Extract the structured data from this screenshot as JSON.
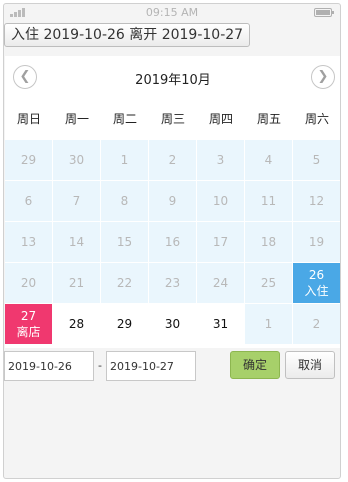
{
  "status_bar": {
    "time": "09:15 AM",
    "icons": [
      "signal-icon",
      "battery-icon"
    ]
  },
  "range_button": {
    "label": "入住 2019-10-26 离开 2019-10-27"
  },
  "calendar": {
    "title": "2019年10月",
    "prev_icon": "chevron-left-icon",
    "next_icon": "chevron-right-icon",
    "weekdays": [
      "周日",
      "周一",
      "周二",
      "周三",
      "周四",
      "周五",
      "周六"
    ],
    "days": [
      {
        "day": "29",
        "state": "prev"
      },
      {
        "day": "30",
        "state": "prev"
      },
      {
        "day": "1",
        "state": "prev"
      },
      {
        "day": "2",
        "state": "prev"
      },
      {
        "day": "3",
        "state": "prev"
      },
      {
        "day": "4",
        "state": "prev"
      },
      {
        "day": "5",
        "state": "prev"
      },
      {
        "day": "6",
        "state": "prev"
      },
      {
        "day": "7",
        "state": "prev"
      },
      {
        "day": "8",
        "state": "prev"
      },
      {
        "day": "9",
        "state": "prev"
      },
      {
        "day": "10",
        "state": "prev"
      },
      {
        "day": "11",
        "state": "prev"
      },
      {
        "day": "12",
        "state": "prev"
      },
      {
        "day": "13",
        "state": "prev"
      },
      {
        "day": "14",
        "state": "prev"
      },
      {
        "day": "15",
        "state": "prev"
      },
      {
        "day": "16",
        "state": "prev"
      },
      {
        "day": "17",
        "state": "prev"
      },
      {
        "day": "18",
        "state": "prev"
      },
      {
        "day": "19",
        "state": "prev"
      },
      {
        "day": "20",
        "state": "prev"
      },
      {
        "day": "21",
        "state": "prev"
      },
      {
        "day": "22",
        "state": "prev"
      },
      {
        "day": "23",
        "state": "prev"
      },
      {
        "day": "24",
        "state": "prev"
      },
      {
        "day": "25",
        "state": "prev"
      },
      {
        "day": "26",
        "state": "checkin",
        "tag": "入住"
      },
      {
        "day": "27",
        "state": "checkout",
        "tag": "离店"
      },
      {
        "day": "28",
        "state": "cur"
      },
      {
        "day": "29",
        "state": "cur"
      },
      {
        "day": "30",
        "state": "cur"
      },
      {
        "day": "31",
        "state": "cur"
      },
      {
        "day": "1",
        "state": "next"
      },
      {
        "day": "2",
        "state": "next"
      }
    ]
  },
  "footer": {
    "start_date": "2019-10-26",
    "separator": "-",
    "end_date": "2019-10-27",
    "confirm_label": "确定",
    "cancel_label": "取消"
  },
  "colors": {
    "checkin": "#4aa8e6",
    "checkout": "#f0386f",
    "confirm": "#a7d06a",
    "unavailable_bg": "#eaf6fd"
  }
}
